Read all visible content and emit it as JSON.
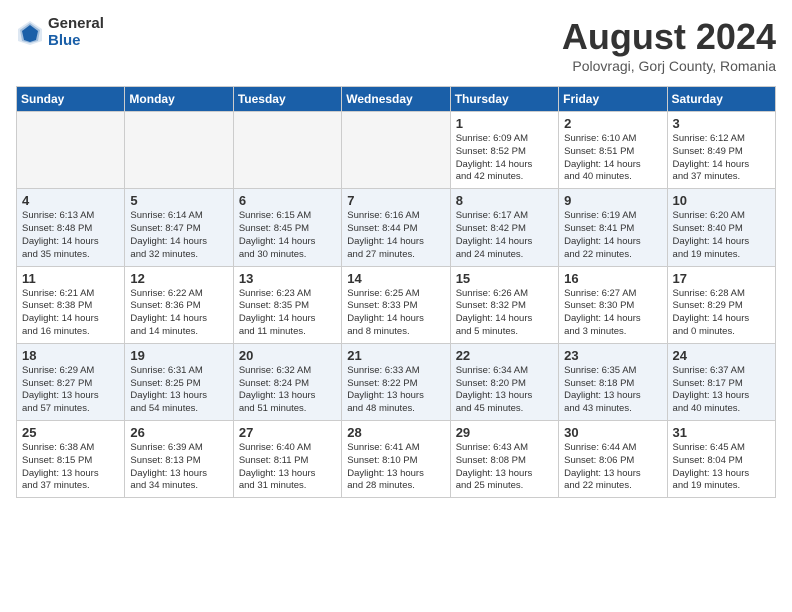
{
  "logo": {
    "general": "General",
    "blue": "Blue"
  },
  "title": "August 2024",
  "subtitle": "Polovragi, Gorj County, Romania",
  "weekdays": [
    "Sunday",
    "Monday",
    "Tuesday",
    "Wednesday",
    "Thursday",
    "Friday",
    "Saturday"
  ],
  "weeks": [
    [
      {
        "day": "",
        "info": ""
      },
      {
        "day": "",
        "info": ""
      },
      {
        "day": "",
        "info": ""
      },
      {
        "day": "",
        "info": ""
      },
      {
        "day": "1",
        "info": "Sunrise: 6:09 AM\nSunset: 8:52 PM\nDaylight: 14 hours\nand 42 minutes."
      },
      {
        "day": "2",
        "info": "Sunrise: 6:10 AM\nSunset: 8:51 PM\nDaylight: 14 hours\nand 40 minutes."
      },
      {
        "day": "3",
        "info": "Sunrise: 6:12 AM\nSunset: 8:49 PM\nDaylight: 14 hours\nand 37 minutes."
      }
    ],
    [
      {
        "day": "4",
        "info": "Sunrise: 6:13 AM\nSunset: 8:48 PM\nDaylight: 14 hours\nand 35 minutes."
      },
      {
        "day": "5",
        "info": "Sunrise: 6:14 AM\nSunset: 8:47 PM\nDaylight: 14 hours\nand 32 minutes."
      },
      {
        "day": "6",
        "info": "Sunrise: 6:15 AM\nSunset: 8:45 PM\nDaylight: 14 hours\nand 30 minutes."
      },
      {
        "day": "7",
        "info": "Sunrise: 6:16 AM\nSunset: 8:44 PM\nDaylight: 14 hours\nand 27 minutes."
      },
      {
        "day": "8",
        "info": "Sunrise: 6:17 AM\nSunset: 8:42 PM\nDaylight: 14 hours\nand 24 minutes."
      },
      {
        "day": "9",
        "info": "Sunrise: 6:19 AM\nSunset: 8:41 PM\nDaylight: 14 hours\nand 22 minutes."
      },
      {
        "day": "10",
        "info": "Sunrise: 6:20 AM\nSunset: 8:40 PM\nDaylight: 14 hours\nand 19 minutes."
      }
    ],
    [
      {
        "day": "11",
        "info": "Sunrise: 6:21 AM\nSunset: 8:38 PM\nDaylight: 14 hours\nand 16 minutes."
      },
      {
        "day": "12",
        "info": "Sunrise: 6:22 AM\nSunset: 8:36 PM\nDaylight: 14 hours\nand 14 minutes."
      },
      {
        "day": "13",
        "info": "Sunrise: 6:23 AM\nSunset: 8:35 PM\nDaylight: 14 hours\nand 11 minutes."
      },
      {
        "day": "14",
        "info": "Sunrise: 6:25 AM\nSunset: 8:33 PM\nDaylight: 14 hours\nand 8 minutes."
      },
      {
        "day": "15",
        "info": "Sunrise: 6:26 AM\nSunset: 8:32 PM\nDaylight: 14 hours\nand 5 minutes."
      },
      {
        "day": "16",
        "info": "Sunrise: 6:27 AM\nSunset: 8:30 PM\nDaylight: 14 hours\nand 3 minutes."
      },
      {
        "day": "17",
        "info": "Sunrise: 6:28 AM\nSunset: 8:29 PM\nDaylight: 14 hours\nand 0 minutes."
      }
    ],
    [
      {
        "day": "18",
        "info": "Sunrise: 6:29 AM\nSunset: 8:27 PM\nDaylight: 13 hours\nand 57 minutes."
      },
      {
        "day": "19",
        "info": "Sunrise: 6:31 AM\nSunset: 8:25 PM\nDaylight: 13 hours\nand 54 minutes."
      },
      {
        "day": "20",
        "info": "Sunrise: 6:32 AM\nSunset: 8:24 PM\nDaylight: 13 hours\nand 51 minutes."
      },
      {
        "day": "21",
        "info": "Sunrise: 6:33 AM\nSunset: 8:22 PM\nDaylight: 13 hours\nand 48 minutes."
      },
      {
        "day": "22",
        "info": "Sunrise: 6:34 AM\nSunset: 8:20 PM\nDaylight: 13 hours\nand 45 minutes."
      },
      {
        "day": "23",
        "info": "Sunrise: 6:35 AM\nSunset: 8:18 PM\nDaylight: 13 hours\nand 43 minutes."
      },
      {
        "day": "24",
        "info": "Sunrise: 6:37 AM\nSunset: 8:17 PM\nDaylight: 13 hours\nand 40 minutes."
      }
    ],
    [
      {
        "day": "25",
        "info": "Sunrise: 6:38 AM\nSunset: 8:15 PM\nDaylight: 13 hours\nand 37 minutes."
      },
      {
        "day": "26",
        "info": "Sunrise: 6:39 AM\nSunset: 8:13 PM\nDaylight: 13 hours\nand 34 minutes."
      },
      {
        "day": "27",
        "info": "Sunrise: 6:40 AM\nSunset: 8:11 PM\nDaylight: 13 hours\nand 31 minutes."
      },
      {
        "day": "28",
        "info": "Sunrise: 6:41 AM\nSunset: 8:10 PM\nDaylight: 13 hours\nand 28 minutes."
      },
      {
        "day": "29",
        "info": "Sunrise: 6:43 AM\nSunset: 8:08 PM\nDaylight: 13 hours\nand 25 minutes."
      },
      {
        "day": "30",
        "info": "Sunrise: 6:44 AM\nSunset: 8:06 PM\nDaylight: 13 hours\nand 22 minutes."
      },
      {
        "day": "31",
        "info": "Sunrise: 6:45 AM\nSunset: 8:04 PM\nDaylight: 13 hours\nand 19 minutes."
      }
    ]
  ]
}
